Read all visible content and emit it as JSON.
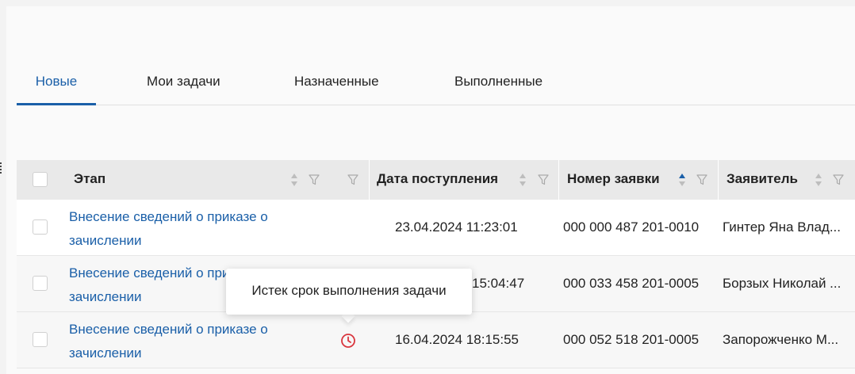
{
  "tabs": [
    {
      "label": "Новые",
      "active": true
    },
    {
      "label": "Мои задачи",
      "active": false
    },
    {
      "label": "Назначенные",
      "active": false
    },
    {
      "label": "Выполненные",
      "active": false
    }
  ],
  "table": {
    "columns": {
      "stage": "Этап",
      "received_date": "Дата поступления",
      "request_number": "Номер заявки",
      "applicant": "Заявитель"
    },
    "sorted_column": "request_number",
    "sort_direction": "ascending",
    "rows": [
      {
        "stage": "Внесение сведений о приказе о зачислении",
        "overdue": false,
        "received_date": "23.04.2024 11:23:01",
        "request_number": "000 000 487 201-0010",
        "applicant": "Гинтер Яна Влад..."
      },
      {
        "stage": "Внесение сведений о приказе о зачислении",
        "overdue": false,
        "received_date": "15:04:47",
        "request_number": "000 033 458 201-0005",
        "applicant": "Борзых Николай ..."
      },
      {
        "stage": "Внесение сведений о приказе о зачислении",
        "overdue": true,
        "received_date": "16.04.2024 18:15:55",
        "request_number": "000 052 518 201-0005",
        "applicant": "Запорожченко М..."
      }
    ]
  },
  "tooltip": {
    "text": "Истек срок выполнения задачи"
  },
  "colors": {
    "accent": "#1a5fa8",
    "overdue": "#d9363e"
  },
  "icons": {
    "sort": "sort-icon",
    "filter": "filter-icon",
    "overdue": "clock-icon"
  }
}
